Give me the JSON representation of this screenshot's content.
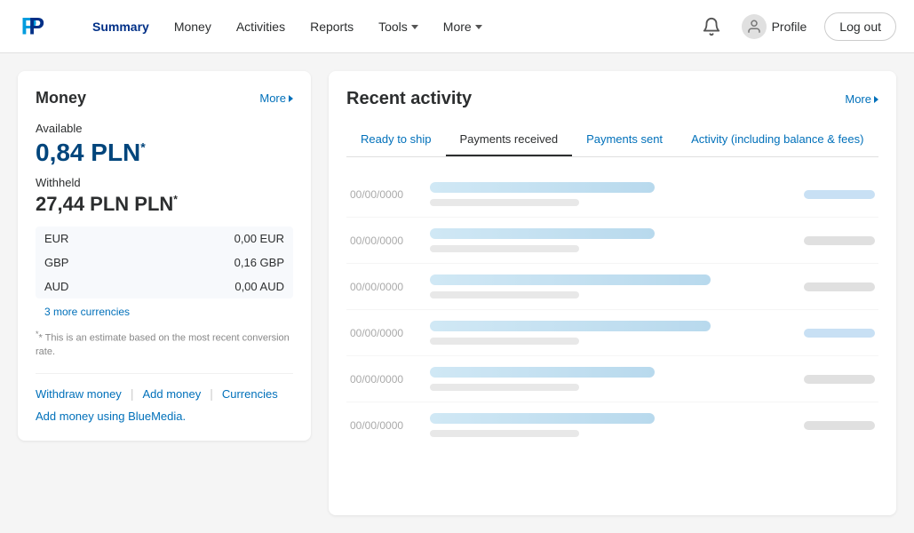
{
  "header": {
    "logo_alt": "PayPal",
    "nav": [
      {
        "id": "summary",
        "label": "Summary",
        "active": true,
        "has_dropdown": false
      },
      {
        "id": "money",
        "label": "Money",
        "active": false,
        "has_dropdown": false
      },
      {
        "id": "activities",
        "label": "Activities",
        "active": false,
        "has_dropdown": false
      },
      {
        "id": "reports",
        "label": "Reports",
        "active": false,
        "has_dropdown": false
      },
      {
        "id": "tools",
        "label": "Tools",
        "active": false,
        "has_dropdown": true
      },
      {
        "id": "more",
        "label": "More",
        "active": false,
        "has_dropdown": true
      }
    ],
    "profile_label": "Profile",
    "logout_label": "Log out"
  },
  "money_panel": {
    "title": "Money",
    "more_label": "More",
    "available_label": "Available",
    "balance": "0,84 PLN",
    "balance_asterisk": "*",
    "withheld_label": "Withheld",
    "withheld_amount": "27,44 PLN PLN",
    "withheld_asterisk": "*",
    "currencies": [
      {
        "code": "EUR",
        "amount": "0,00 EUR"
      },
      {
        "code": "GBP",
        "amount": "0,16 GBP"
      },
      {
        "code": "AUD",
        "amount": "0,00 AUD"
      }
    ],
    "more_currencies_label": "3 more currencies",
    "footnote": "* This is an estimate based on the most recent conversion rate.",
    "actions": [
      {
        "id": "withdraw",
        "label": "Withdraw money"
      },
      {
        "id": "add",
        "label": "Add money"
      },
      {
        "id": "currencies",
        "label": "Currencies"
      }
    ],
    "bluemedia_label": "Add money using BlueMedia."
  },
  "activity_panel": {
    "title": "Recent activity",
    "more_label": "More",
    "tabs": [
      {
        "id": "ready-to-ship",
        "label": "Ready to ship",
        "active": false
      },
      {
        "id": "payments-received",
        "label": "Payments received",
        "active": true
      },
      {
        "id": "payments-sent",
        "label": "Payments sent",
        "active": false
      },
      {
        "id": "activity-balance-fees",
        "label": "Activity (including balance & fees)",
        "active": false
      }
    ],
    "rows": [
      {
        "date": "00/00/0000",
        "wide": false
      },
      {
        "date": "00/00/0000",
        "wide": false
      },
      {
        "date": "00/00/0000",
        "wide": true
      },
      {
        "date": "00/00/0000",
        "wide": true
      },
      {
        "date": "00/00/0000",
        "wide": false
      },
      {
        "date": "00/00/0000",
        "wide": false
      }
    ]
  }
}
